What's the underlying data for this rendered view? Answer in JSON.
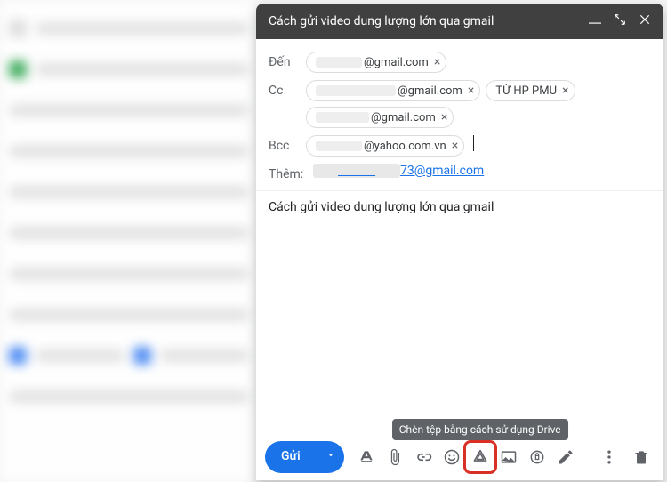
{
  "header": {
    "title": "Cách gửi video dung lượng lớn qua gmail"
  },
  "recipients": {
    "to_label": "Đến",
    "cc_label": "Cc",
    "bcc_label": "Bcc",
    "extra_label": "Thêm:",
    "to": [
      {
        "text": "@gmail.com"
      }
    ],
    "cc": [
      {
        "text": "@gmail.com"
      },
      {
        "text": "TỪ HP PMU"
      },
      {
        "text": "@gmail.com"
      }
    ],
    "bcc": [
      {
        "text": "@yahoo.com.vn"
      }
    ],
    "extra": "73@gmail.com"
  },
  "subject": "Cách gửi video dung lượng lớn qua gmail",
  "footer": {
    "send_label": "Gửi",
    "drive_tooltip": "Chèn tệp bằng cách sử dụng Drive"
  }
}
